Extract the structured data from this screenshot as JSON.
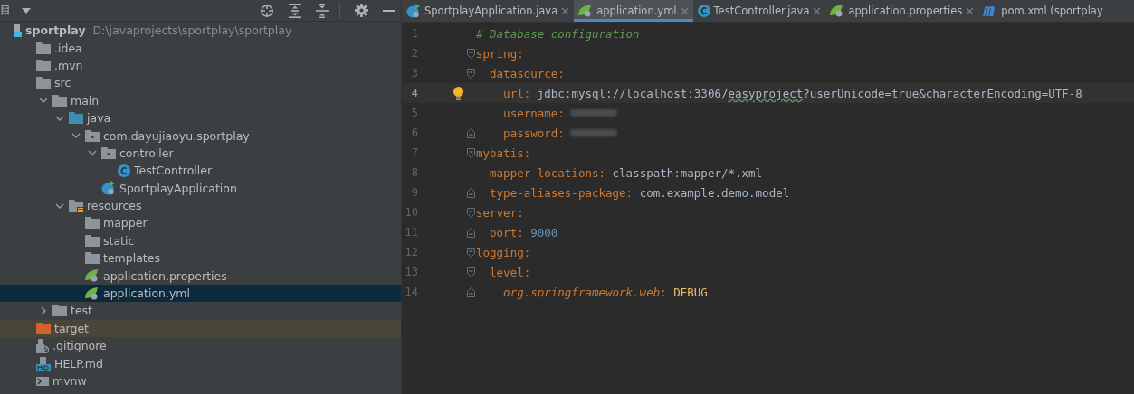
{
  "project_panel": {
    "title": "目",
    "tree": [
      {
        "name": "sportplay",
        "path": "D:\\javaprojects\\sportplay\\sportplay",
        "kind": "module",
        "selected": false,
        "children": [
          {
            "name": ".idea",
            "kind": "folder",
            "selected": false
          },
          {
            "name": ".mvn",
            "kind": "folder",
            "selected": false
          },
          {
            "name": "src",
            "kind": "folder",
            "selected": false,
            "children": [
              {
                "name": "main",
                "kind": "folder",
                "expanded": true,
                "selected": false,
                "children": [
                  {
                    "name": "java",
                    "kind": "source-folder",
                    "expanded": true,
                    "selected": false,
                    "children": [
                      {
                        "name": "com.dayujiaoyu.sportplay",
                        "kind": "package",
                        "expanded": true,
                        "selected": false,
                        "children": [
                          {
                            "name": "controller",
                            "kind": "package",
                            "expanded": true,
                            "selected": false,
                            "children": [
                              {
                                "name": "TestController",
                                "kind": "class",
                                "selected": false
                              }
                            ]
                          },
                          {
                            "name": "SportplayApplication",
                            "kind": "spring-class",
                            "selected": false
                          }
                        ]
                      }
                    ]
                  },
                  {
                    "name": "resources",
                    "kind": "resources-folder",
                    "expanded": true,
                    "selected": false,
                    "children": [
                      {
                        "name": "mapper",
                        "kind": "folder",
                        "selected": false
                      },
                      {
                        "name": "static",
                        "kind": "folder",
                        "selected": false
                      },
                      {
                        "name": "templates",
                        "kind": "folder",
                        "selected": false
                      },
                      {
                        "name": "application.properties",
                        "kind": "spring-config",
                        "selected": false
                      },
                      {
                        "name": "application.yml",
                        "kind": "spring-config",
                        "selected": true
                      }
                    ]
                  }
                ]
              },
              {
                "name": "test",
                "kind": "folder",
                "expanded": false,
                "selected": false
              }
            ]
          },
          {
            "name": "target",
            "kind": "excluded-folder",
            "selected": false
          },
          {
            "name": ".gitignore",
            "kind": "ignore-file",
            "selected": false
          },
          {
            "name": "HELP.md",
            "kind": "markdown-file",
            "selected": false
          },
          {
            "name": "mvnw",
            "kind": "script-file",
            "selected": false
          }
        ]
      }
    ]
  },
  "tabs": [
    {
      "label": "SportplayApplication.java",
      "kind": "spring-class",
      "selected": false
    },
    {
      "label": "application.yml",
      "kind": "spring-config",
      "selected": true
    },
    {
      "label": "TestController.java",
      "kind": "class",
      "selected": false
    },
    {
      "label": "application.properties",
      "kind": "spring-config",
      "selected": false
    },
    {
      "label": "pom.xml (sportplay",
      "kind": "maven",
      "selected": false
    }
  ],
  "editor": {
    "lines": [
      {
        "number": "1",
        "tokens": [
          {
            "kind": "comment",
            "text": "# Database configuration"
          }
        ]
      },
      {
        "number": "2",
        "fold_start": true,
        "tokens": [
          {
            "kind": "key",
            "text": "spring"
          },
          {
            "kind": "punct",
            "text": ":"
          }
        ]
      },
      {
        "number": "3",
        "fold_start": true,
        "tokens": [
          {
            "kind": "key",
            "text": "  datasource"
          },
          {
            "kind": "punct",
            "text": ":"
          }
        ]
      },
      {
        "number": "4",
        "current": true,
        "bulb": true,
        "tokens": [
          {
            "kind": "key",
            "text": "    url"
          },
          {
            "kind": "punct",
            "text": ": "
          },
          {
            "kind": "value",
            "text": "jdbc:mysql://localhost:3306/"
          },
          {
            "kind": "typo",
            "text": "easyproject"
          },
          {
            "kind": "value",
            "text": "?userUnicode=true&characterEncoding=UTF-8"
          }
        ]
      },
      {
        "number": "5",
        "redacted": true,
        "tokens": [
          {
            "kind": "key",
            "text": "    username"
          },
          {
            "kind": "punct",
            "text": ":"
          }
        ]
      },
      {
        "number": "6",
        "fold_end": true,
        "redacted": true,
        "tokens": [
          {
            "kind": "key",
            "text": "    password"
          },
          {
            "kind": "punct",
            "text": ":"
          }
        ]
      },
      {
        "number": "7",
        "fold_start": true,
        "tokens": [
          {
            "kind": "key",
            "text": "mybatis"
          },
          {
            "kind": "punct",
            "text": ":"
          }
        ]
      },
      {
        "number": "8",
        "tokens": [
          {
            "kind": "key",
            "text": "  mapper-locations"
          },
          {
            "kind": "punct",
            "text": ": "
          },
          {
            "kind": "value",
            "text": "classpath:mapper/*.xml"
          }
        ]
      },
      {
        "number": "9",
        "fold_end": true,
        "tokens": [
          {
            "kind": "key",
            "text": "  type-aliases-package"
          },
          {
            "kind": "punct",
            "text": ": "
          },
          {
            "kind": "value",
            "text": "com.example.demo.model"
          }
        ]
      },
      {
        "number": "10",
        "fold_start": true,
        "tokens": [
          {
            "kind": "key",
            "text": "server"
          },
          {
            "kind": "punct",
            "text": ":"
          }
        ]
      },
      {
        "number": "11",
        "fold_end": true,
        "tokens": [
          {
            "kind": "key",
            "text": "  port"
          },
          {
            "kind": "punct",
            "text": ": "
          },
          {
            "kind": "number",
            "text": "9000"
          }
        ]
      },
      {
        "number": "12",
        "fold_start": true,
        "tokens": [
          {
            "kind": "key",
            "text": "logging"
          },
          {
            "kind": "punct",
            "text": ":"
          }
        ]
      },
      {
        "number": "13",
        "fold_start": true,
        "tokens": [
          {
            "kind": "key",
            "text": "  level"
          },
          {
            "kind": "punct",
            "text": ":"
          }
        ]
      },
      {
        "number": "14",
        "fold_end": true,
        "tokens": [
          {
            "kind": "italic-key",
            "text": "    org.springframework.web"
          },
          {
            "kind": "punct",
            "text": ": "
          },
          {
            "kind": "constant",
            "text": "DEBUG"
          }
        ]
      }
    ]
  }
}
